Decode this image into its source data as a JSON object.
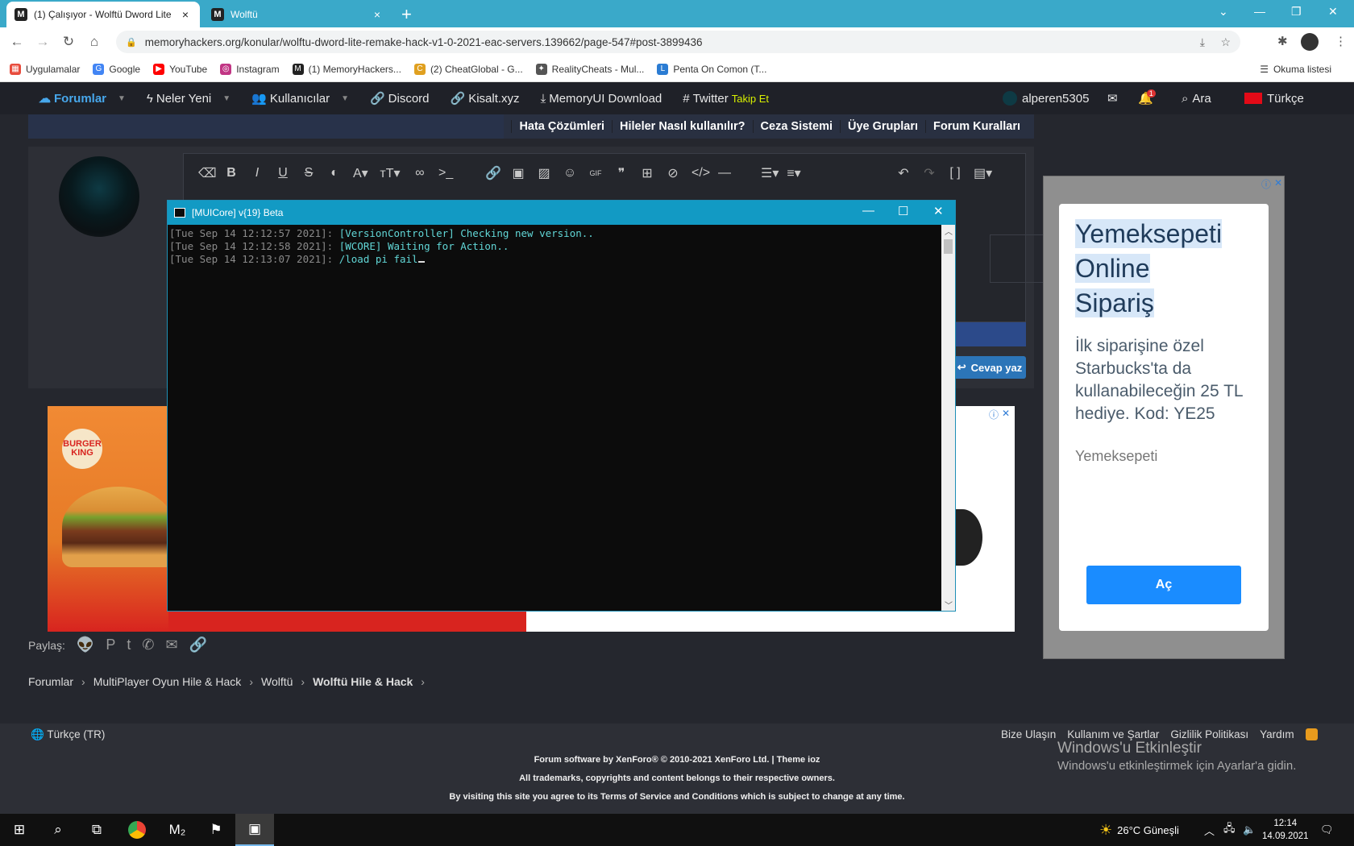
{
  "browser": {
    "tabs": [
      {
        "title": "(1) Çalışıyor - Wolftü Dword Lite",
        "close": "×"
      },
      {
        "title": "Wolftü",
        "close": "×"
      }
    ],
    "new_tab": "+",
    "url": "memoryhackers.org/konular/wolftu-dword-lite-remake-hack-v1-0-2021-eac-servers.139662/page-547#post-3899436",
    "bookmarks": [
      {
        "label": "Uygulamalar",
        "icon": "apps-grid-icon",
        "color": "#e84c3d"
      },
      {
        "label": "Google",
        "icon": "google-icon",
        "color": "#4285f4"
      },
      {
        "label": "YouTube",
        "icon": "youtube-icon",
        "color": "#ff0000"
      },
      {
        "label": "Instagram",
        "icon": "instagram-icon",
        "color": "#c13584"
      },
      {
        "label": "(1) MemoryHackers...",
        "icon": "memoryhackers-icon",
        "color": "#222222"
      },
      {
        "label": "(2) CheatGlobal - G...",
        "icon": "cheatglobal-icon",
        "color": "#e0a020"
      },
      {
        "label": "RealityCheats - Mul...",
        "icon": "realitycheats-icon",
        "color": "#555555"
      },
      {
        "label": "Penta On Comon (T...",
        "icon": "penta-icon",
        "color": "#2b7cd3"
      }
    ],
    "reading_list": "Okuma listesi"
  },
  "forum_nav": {
    "items": [
      {
        "label": "Forumlar",
        "icon": "chat-icon"
      },
      {
        "label": "Neler Yeni",
        "icon": "bolt-icon"
      },
      {
        "label": "Kullanıcılar",
        "icon": "users-icon"
      },
      {
        "label": "Discord",
        "icon": "link-icon"
      },
      {
        "label": "Kisalt.xyz",
        "icon": "link-icon"
      },
      {
        "label": "MemoryUI Download",
        "icon": "download-icon"
      },
      {
        "label": "Twitter",
        "icon": "hash-icon"
      }
    ],
    "twitter_follow": "Takip Et",
    "username": "alperen5305",
    "notifications": "1",
    "search": "Ara",
    "language": "Türkçe"
  },
  "sub_nav": [
    "Hata Çözümleri",
    "Hileler Nasıl kullanılır?",
    "Ceza Sistemi",
    "Üye Grupları",
    "Forum Kuralları"
  ],
  "reply": {
    "button": "Cevap yaz"
  },
  "console": {
    "title": "[MUICore] v{19} Beta",
    "lines": [
      {
        "ts": "[Tue Sep 14 12:12:57 2021]:",
        "msg": "[VersionController] Checking new version.."
      },
      {
        "ts": "[Tue Sep 14 12:12:58 2021]:",
        "msg": "[WCORE] Waiting for Action.."
      },
      {
        "ts": "[Tue Sep 14 12:13:07 2021]:",
        "msg": "/load pi fail"
      }
    ]
  },
  "ads": {
    "burger_logo": "BURGER KING",
    "side_title_lines": [
      "Yemeksepeti",
      "Online",
      "Sipariş"
    ],
    "side_text": "İlk siparişine özel Starbucks'ta da kullanabileceğin 25 TL hediye. Kod: YE25",
    "side_brand": "Yemeksepeti",
    "side_button": "Aç"
  },
  "share": {
    "label": "Paylaş:"
  },
  "breadcrumb": [
    "Forumlar",
    "MultiPlayer Oyun Hile & Hack",
    "Wolftü",
    "Wolftü Hile & Hack"
  ],
  "footer": {
    "language": "Türkçe (TR)",
    "links": [
      "Bize Ulaşın",
      "Kullanım ve Şartlar",
      "Gizlilik Politikası",
      "Yardım"
    ],
    "line1": "Forum software by XenForo® © 2010-2021 XenForo Ltd. | Theme ioz",
    "line2": "All trademarks, copyrights and content belongs to their respective owners.",
    "line3": "By visiting this site you agree to its Terms of Service and Conditions which is subject to change at any time."
  },
  "watermark": {
    "title": "Windows'u Etkinleştir",
    "text": "Windows'u etkinleştirmek için Ayarlar'a gidin."
  },
  "taskbar": {
    "weather": "26°C  Güneşli",
    "time": "12:14",
    "date": "14.09.2021"
  }
}
